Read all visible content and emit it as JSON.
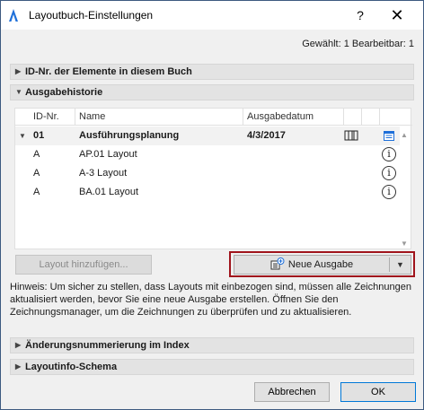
{
  "window": {
    "title": "Layoutbuch-Einstellungen",
    "help_label": "?",
    "close_label": "✕"
  },
  "summary": "Gewählt: 1 Bearbeitbar: 1",
  "sections": {
    "id_section": "ID-Nr. der Elemente in diesem Buch",
    "history_section": "Ausgabehistorie",
    "revision_section": "Änderungsnummerierung im Index",
    "schema_section": "Layoutinfo-Schema"
  },
  "table": {
    "headers": [
      "ID-Nr.",
      "Name",
      "Ausgabedatum"
    ],
    "group": {
      "id": "01",
      "name": "Ausführungsplanung",
      "date": "4/3/2017"
    },
    "rows": [
      {
        "id": "A",
        "name": "AP.01 Layout"
      },
      {
        "id": "A",
        "name": "A-3 Layout"
      },
      {
        "id": "A",
        "name": "BA.01 Layout"
      }
    ]
  },
  "buttons": {
    "add_layout": "Layout hinzufügen...",
    "new_issue": "Neue Ausgabe",
    "cancel": "Abbrechen",
    "ok": "OK"
  },
  "hint": "Hinweis: Um sicher zu stellen, dass Layouts mit einbezogen sind, müssen alle Zeichnungen aktualisiert werden, bevor Sie eine neue Ausgabe erstellen. Öffnen Sie den Zeichnungsmanager, um die Zeichnungen zu überprüfen und zu aktualisieren.",
  "colors": {
    "highlight": "#a0141c",
    "accent_blue": "#1e6fd9"
  }
}
